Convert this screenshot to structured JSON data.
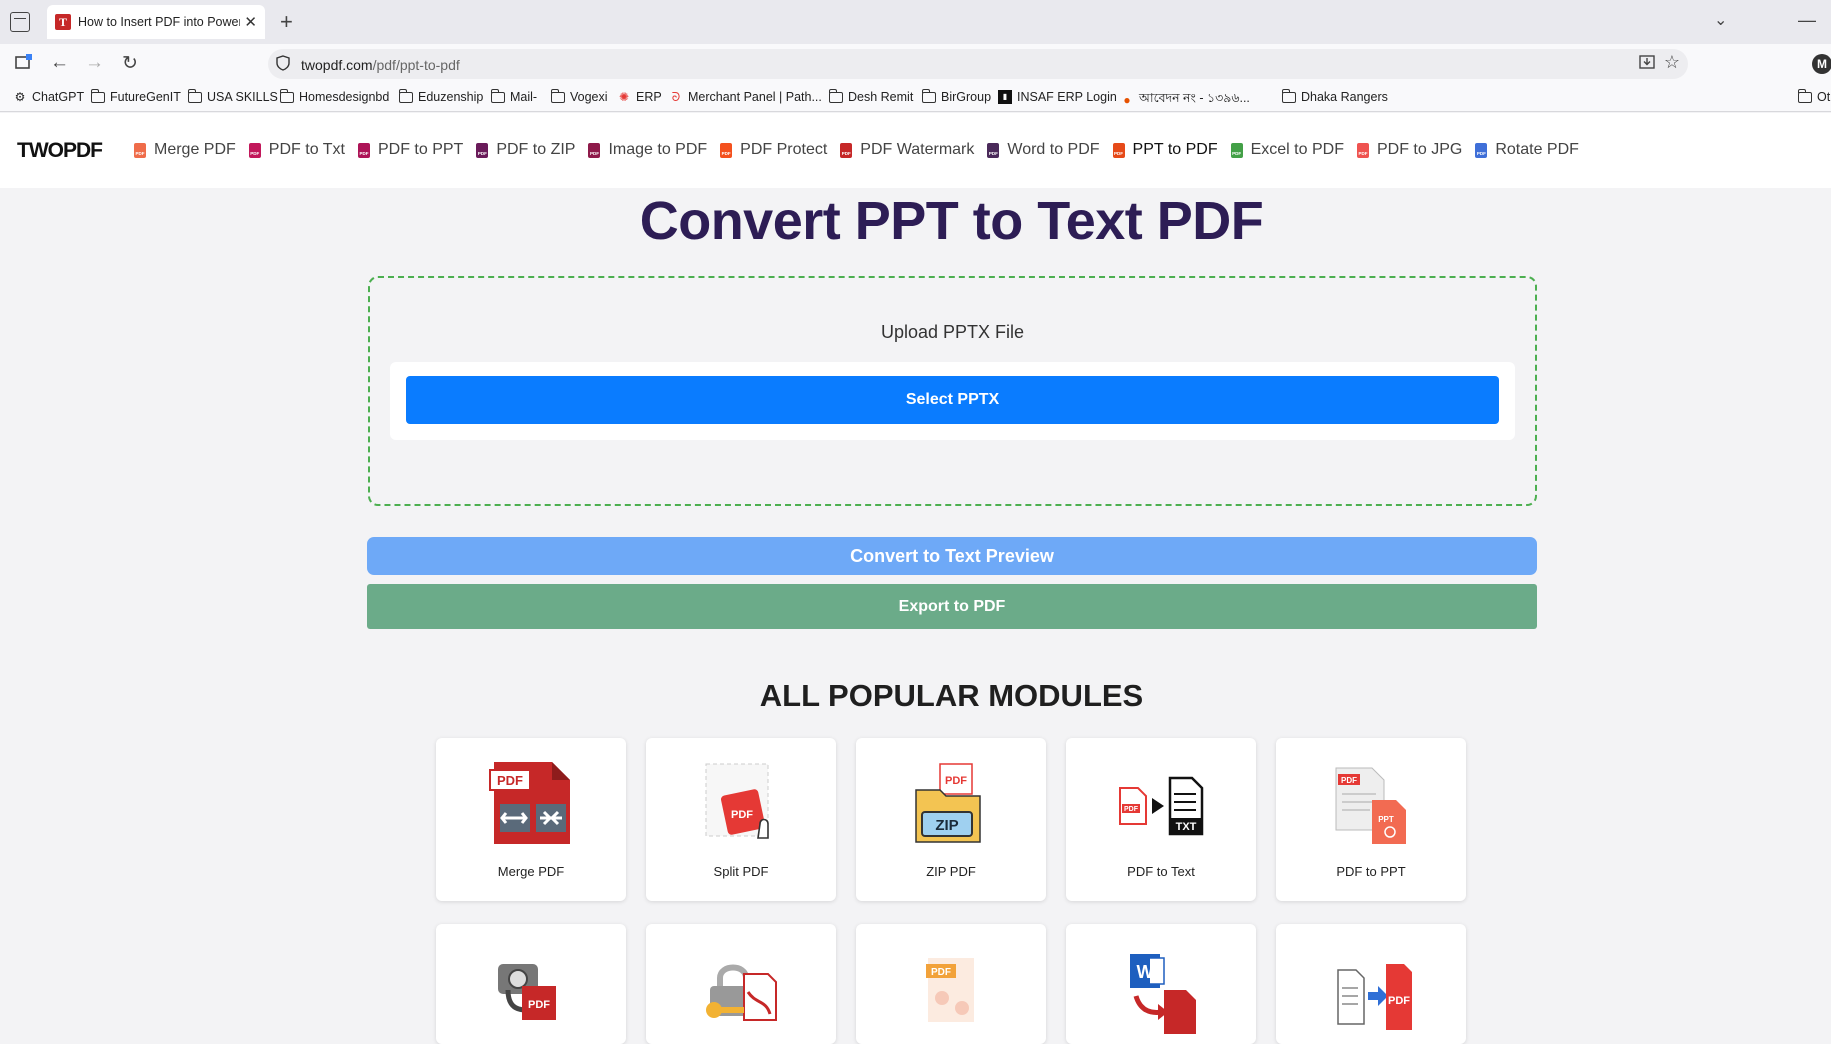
{
  "browser": {
    "tab_title": "How to Insert PDF into PowerPoint",
    "tab_favicon_letter": "T",
    "new_tab_label": "+",
    "url_host": "twopdf.com",
    "url_path": "/pdf/ppt-to-pdf",
    "profile_initial": "M"
  },
  "bookmarks": [
    {
      "label": "ChatGPT",
      "icon": "openai-icon"
    },
    {
      "label": "FutureGenIT",
      "icon": "folder-icon"
    },
    {
      "label": "USA SKILLS",
      "icon": "folder-icon"
    },
    {
      "label": "Homesdesignbd",
      "icon": "folder-icon"
    },
    {
      "label": "Eduzenship",
      "icon": "folder-icon"
    },
    {
      "label": "Mail-",
      "icon": "folder-icon"
    },
    {
      "label": "Vogexi",
      "icon": "folder-icon"
    },
    {
      "label": "ERP",
      "icon": "erp-icon"
    },
    {
      "label": "Merchant Panel | Path...",
      "icon": "pathao-icon"
    },
    {
      "label": "Desh Remit",
      "icon": "folder-icon"
    },
    {
      "label": "BirGroup",
      "icon": "folder-icon"
    },
    {
      "label": "INSAF ERP Login",
      "icon": "insaf-icon"
    },
    {
      "label": "আবেদন নং - ১৩৯৬...",
      "icon": "govt-icon"
    },
    {
      "label": "Dhaka Rangers",
      "icon": "folder-icon"
    },
    {
      "label": "Oth",
      "icon": "folder-icon"
    }
  ],
  "site": {
    "logo": "TWOPDF",
    "nav": [
      {
        "label": "Merge PDF",
        "color": "#ef6c4a"
      },
      {
        "label": "PDF to Txt",
        "color": "#c2185b"
      },
      {
        "label": "PDF to PPT",
        "color": "#ad1457"
      },
      {
        "label": "PDF to ZIP",
        "color": "#6a1b5a"
      },
      {
        "label": "Image to PDF",
        "color": "#8e1a4a"
      },
      {
        "label": "PDF Protect",
        "color": "#f4511e"
      },
      {
        "label": "PDF Watermark",
        "color": "#c62828"
      },
      {
        "label": "Word to PDF",
        "color": "#4a2a5a"
      },
      {
        "label": "PPT to PDF",
        "color": "#e64a19"
      },
      {
        "label": "Excel to PDF",
        "color": "#43a047"
      },
      {
        "label": "PDF to JPG",
        "color": "#ef5350"
      },
      {
        "label": "Rotate PDF",
        "color": "#3f6fd8"
      }
    ],
    "active_nav": "PPT to PDF"
  },
  "main": {
    "title": "Convert PPT to Text PDF",
    "upload_label": "Upload PPTX File",
    "select_button": "Select PPTX",
    "convert_button": "Convert to Text Preview",
    "export_button": "Export to PDF"
  },
  "modules": {
    "title": "ALL POPULAR MODULES",
    "items": [
      {
        "label": "Merge PDF",
        "icon": "merge-pdf-icon"
      },
      {
        "label": "Split PDF",
        "icon": "split-pdf-icon"
      },
      {
        "label": "ZIP PDF",
        "icon": "zip-pdf-icon"
      },
      {
        "label": "PDF to Text",
        "icon": "pdf-to-text-icon"
      },
      {
        "label": "PDF to PPT",
        "icon": "pdf-to-ppt-icon"
      }
    ],
    "row2_icons": [
      "camera-pdf-icon",
      "lock-pdf-icon",
      "pdf-doc-icon",
      "word-to-pdf-icon",
      "file-to-pdf-icon"
    ]
  },
  "colors": {
    "title": "#2d1d55",
    "select_button": "#0a7cff",
    "convert_button": "#6ea9f7",
    "export_button": "#6bab89",
    "upload_border": "#4caf50"
  }
}
